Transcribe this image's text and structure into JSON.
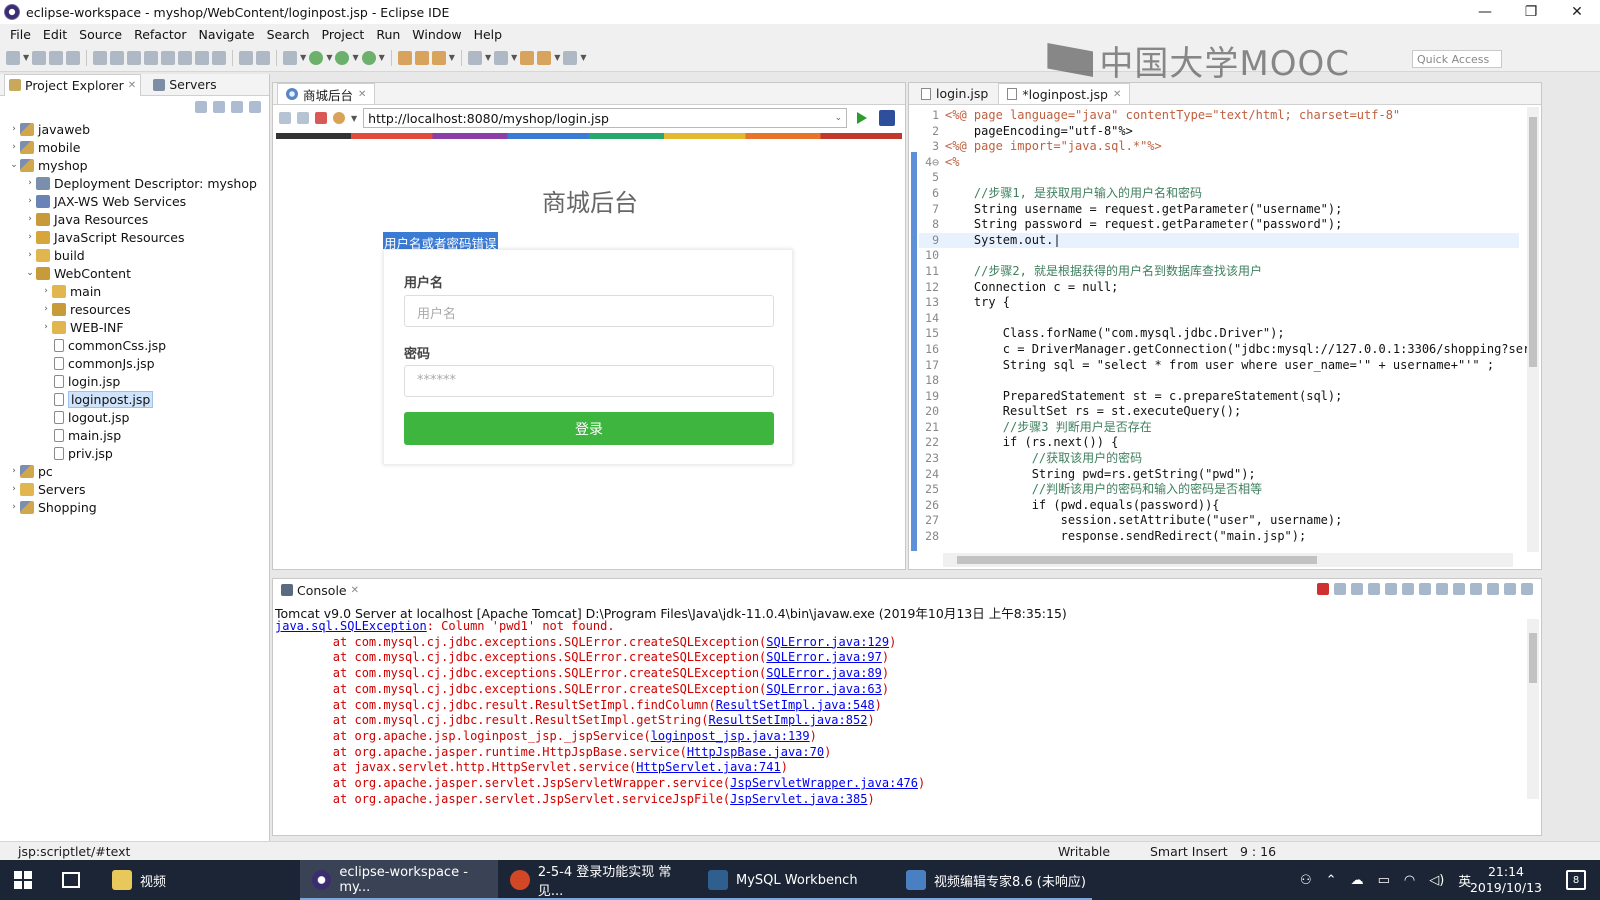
{
  "window": {
    "title": "eclipse-workspace - myshop/WebContent/loginpost.jsp - Eclipse IDE",
    "minimize": "—",
    "maximize": "❐",
    "close": "✕"
  },
  "menu": [
    "File",
    "Edit",
    "Source",
    "Refactor",
    "Navigate",
    "Search",
    "Project",
    "Run",
    "Window",
    "Help"
  ],
  "watermark": "中国大学MOOC",
  "quick_access": "Quick Access",
  "explorer": {
    "tabs": [
      {
        "label": "Project Explorer",
        "close": "✕"
      },
      {
        "label": "Servers"
      }
    ],
    "tree": [
      {
        "label": "javaweb",
        "depth": 0,
        "arrow": "›",
        "icon": "project"
      },
      {
        "label": "mobile",
        "depth": 0,
        "arrow": "›",
        "icon": "project"
      },
      {
        "label": "myshop",
        "depth": 0,
        "arrow": "⌄",
        "icon": "project"
      },
      {
        "label": "Deployment Descriptor: myshop",
        "depth": 1,
        "arrow": "›",
        "icon": "descriptor"
      },
      {
        "label": "JAX-WS Web Services",
        "depth": 1,
        "arrow": "›",
        "icon": "webservices"
      },
      {
        "label": "Java Resources",
        "depth": 1,
        "arrow": "›",
        "icon": "source-folder"
      },
      {
        "label": "JavaScript Resources",
        "depth": 1,
        "arrow": "›",
        "icon": "js"
      },
      {
        "label": "build",
        "depth": 1,
        "arrow": "›",
        "icon": "folder"
      },
      {
        "label": "WebContent",
        "depth": 1,
        "arrow": "⌄",
        "icon": "source-folder"
      },
      {
        "label": "main",
        "depth": 2,
        "arrow": "›",
        "icon": "folder"
      },
      {
        "label": "resources",
        "depth": 2,
        "arrow": "›",
        "icon": "source-folder"
      },
      {
        "label": "WEB-INF",
        "depth": 2,
        "arrow": "›",
        "icon": "folder"
      },
      {
        "label": "commonCss.jsp",
        "depth": 2,
        "arrow": "",
        "icon": "file"
      },
      {
        "label": "commonJs.jsp",
        "depth": 2,
        "arrow": "",
        "icon": "file"
      },
      {
        "label": "login.jsp",
        "depth": 2,
        "arrow": "",
        "icon": "file"
      },
      {
        "label": "loginpost.jsp",
        "depth": 2,
        "arrow": "",
        "icon": "file",
        "selected": true
      },
      {
        "label": "logout.jsp",
        "depth": 2,
        "arrow": "",
        "icon": "file"
      },
      {
        "label": "main.jsp",
        "depth": 2,
        "arrow": "",
        "icon": "file"
      },
      {
        "label": "priv.jsp",
        "depth": 2,
        "arrow": "",
        "icon": "file"
      },
      {
        "label": "pc",
        "depth": 0,
        "arrow": "›",
        "icon": "project"
      },
      {
        "label": "Servers",
        "depth": 0,
        "arrow": "›",
        "icon": "folder"
      },
      {
        "label": "Shopping",
        "depth": 0,
        "arrow": "›",
        "icon": "project"
      }
    ]
  },
  "browser": {
    "tab_label": "商城后台",
    "tab_close": "✕",
    "url": "http://localhost:8080/myshop/login.jsp",
    "page": {
      "title": "商城后台",
      "error": "用户名或者密码错误",
      "username_label": "用户名",
      "username_placeholder": "用户名",
      "password_label": "密码",
      "password_placeholder": "******",
      "login_button": "登录"
    }
  },
  "editor": {
    "tabs": [
      {
        "label": "login.jsp",
        "active": false
      },
      {
        "label": "*loginpost.jsp",
        "active": true,
        "close": "✕"
      }
    ],
    "lines": [
      {
        "n": "1",
        "t": "<%@ page language=\"java\" contentType=\"text/html; charset=utf-8\""
      },
      {
        "n": "2",
        "t": "    pageEncoding=\"utf-8\"%>"
      },
      {
        "n": "3",
        "t": "<%@ page import=\"java.sql.*\"%>"
      },
      {
        "n": "4⊖",
        "t": "<%"
      },
      {
        "n": "5",
        "t": ""
      },
      {
        "n": "6",
        "t": "    //步骤1, 是获取用户输入的用户名和密码"
      },
      {
        "n": "7",
        "t": "    String username = request.getParameter(\"username\");"
      },
      {
        "n": "8",
        "t": "    String password = request.getParameter(\"password\");"
      },
      {
        "n": "9",
        "t": "    System.out.|"
      },
      {
        "n": "10",
        "t": ""
      },
      {
        "n": "11",
        "t": "    //步骤2, 就是根据获得的用户名到数据库查找该用户"
      },
      {
        "n": "12",
        "t": "    Connection c = null;"
      },
      {
        "n": "13",
        "t": "    try {"
      },
      {
        "n": "14",
        "t": ""
      },
      {
        "n": "15",
        "t": "        Class.forName(\"com.mysql.jdbc.Driver\");"
      },
      {
        "n": "16",
        "t": "        c = DriverManager.getConnection(\"jdbc:mysql://127.0.0.1:3306/shopping?ser"
      },
      {
        "n": "17",
        "t": "        String sql = \"select * from user where user_name='\" + username+\"'\" ;"
      },
      {
        "n": "18",
        "t": ""
      },
      {
        "n": "19",
        "t": "        PreparedStatement st = c.prepareStatement(sql);"
      },
      {
        "n": "20",
        "t": "        ResultSet rs = st.executeQuery();"
      },
      {
        "n": "21",
        "t": "        //步骤3 判断用户是否存在"
      },
      {
        "n": "22",
        "t": "        if (rs.next()) {"
      },
      {
        "n": "23",
        "t": "            //获取该用户的密码"
      },
      {
        "n": "24",
        "t": "            String pwd=rs.getString(\"pwd\");"
      },
      {
        "n": "25",
        "t": "            //判断该用户的密码和输入的密码是否相等"
      },
      {
        "n": "26",
        "t": "            if (pwd.equals(password)){"
      },
      {
        "n": "27",
        "t": "                session.setAttribute(\"user\", username);"
      },
      {
        "n": "28",
        "t": "                response.sendRedirect(\"main.jsp\");"
      }
    ]
  },
  "console": {
    "tab_label": "Console",
    "tab_close": "✕",
    "header": "Tomcat v9.0 Server at localhost [Apache Tomcat] D:\\Program Files\\Java\\jdk-11.0.4\\bin\\javaw.exe (2019年10月13日 上午8:35:15)",
    "exception_link": "java.sql.SQLException",
    "exception_msg": ": Column 'pwd1' not found.",
    "trace": [
      {
        "pre": "\tat com.mysql.cj.jdbc.exceptions.SQLError.createSQLException(",
        "link": "SQLError.java:129",
        "post": ")"
      },
      {
        "pre": "\tat com.mysql.cj.jdbc.exceptions.SQLError.createSQLException(",
        "link": "SQLError.java:97",
        "post": ")"
      },
      {
        "pre": "\tat com.mysql.cj.jdbc.exceptions.SQLError.createSQLException(",
        "link": "SQLError.java:89",
        "post": ")"
      },
      {
        "pre": "\tat com.mysql.cj.jdbc.exceptions.SQLError.createSQLException(",
        "link": "SQLError.java:63",
        "post": ")"
      },
      {
        "pre": "\tat com.mysql.cj.jdbc.result.ResultSetImpl.findColumn(",
        "link": "ResultSetImpl.java:548",
        "post": ")"
      },
      {
        "pre": "\tat com.mysql.cj.jdbc.result.ResultSetImpl.getString(",
        "link": "ResultSetImpl.java:852",
        "post": ")"
      },
      {
        "pre": "\tat org.apache.jsp.loginpost_jsp._jspService(",
        "link": "loginpost_jsp.java:139",
        "post": ")"
      },
      {
        "pre": "\tat org.apache.jasper.runtime.HttpJspBase.service(",
        "link": "HttpJspBase.java:70",
        "post": ")"
      },
      {
        "pre": "\tat javax.servlet.http.HttpServlet.service(",
        "link": "HttpServlet.java:741",
        "post": ")"
      },
      {
        "pre": "\tat org.apache.jasper.servlet.JspServletWrapper.service(",
        "link": "JspServletWrapper.java:476",
        "post": ")"
      },
      {
        "pre": "\tat org.apache.jasper.servlet.JspServlet.serviceJspFile(",
        "link": "JspServlet.java:385",
        "post": ")"
      }
    ]
  },
  "status": {
    "path": "jsp:scriptlet/#text",
    "mode": "Writable",
    "insert": "Smart Insert",
    "position": "9 : 16"
  },
  "taskbar": {
    "apps": [
      {
        "label": "视频",
        "active": false
      },
      {
        "label": "eclipse-workspace - my...",
        "active": true
      },
      {
        "label": "2-5-4 登录功能实现  常见...",
        "active": false
      },
      {
        "label": "MySQL Workbench",
        "active": false
      },
      {
        "label": "视频编辑专家8.6 (未响应)",
        "active": false
      }
    ],
    "ime": "英",
    "time": "21:14",
    "date": "2019/10/13",
    "notifications": "8"
  },
  "colors": {
    "accent": "#3b7bd4",
    "login_green": "#3eb53e",
    "error_red": "#d00000"
  }
}
